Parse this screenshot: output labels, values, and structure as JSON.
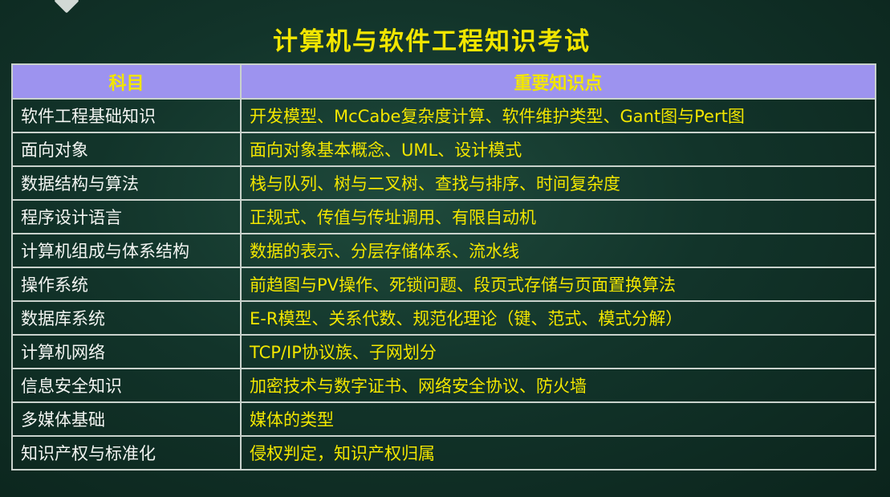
{
  "slide": {
    "title": "计算机与软件工程知识考试"
  },
  "table": {
    "headers": [
      "科目",
      "重要知识点"
    ],
    "rows": [
      {
        "subject": "软件工程基础知识",
        "points": "开发模型、McCabe复杂度计算、软件维护类型、Gant图与Pert图"
      },
      {
        "subject": "面向对象",
        "points": "面向对象基本概念、UML、设计模式"
      },
      {
        "subject": "数据结构与算法",
        "points": "栈与队列、树与二叉树、查找与排序、时间复杂度"
      },
      {
        "subject": "程序设计语言",
        "points": "正规式、传值与传址调用、有限自动机"
      },
      {
        "subject": "计算机组成与体系结构",
        "points": "数据的表示、分层存储体系、流水线"
      },
      {
        "subject": "操作系统",
        "points": "前趋图与PV操作、死锁问题、段页式存储与页面置换算法"
      },
      {
        "subject": "数据库系统",
        "points": "E-R模型、关系代数、规范化理论（键、范式、模式分解）"
      },
      {
        "subject": "计算机网络",
        "points": "TCP/IP协议族、子网划分"
      },
      {
        "subject": "信息安全知识",
        "points": "加密技术与数字证书、网络安全协议、防火墙"
      },
      {
        "subject": "多媒体基础",
        "points": "媒体的类型"
      },
      {
        "subject": "知识产权与标准化",
        "points": "侵权判定，知识产权归属"
      }
    ]
  },
  "colors": {
    "background": "#12342a",
    "title": "#f2e600",
    "header_bg": "#9d93ef",
    "subject_text": "#f3f5f2",
    "points_text": "#f2e600",
    "border": "#c9d2cc"
  },
  "icons": {
    "corner": "arrow-corner-icon"
  }
}
